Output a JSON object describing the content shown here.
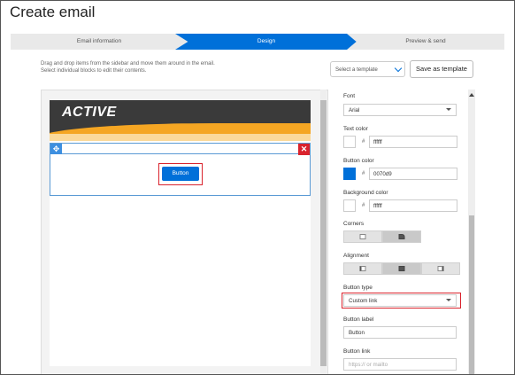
{
  "page": {
    "title": "Create email"
  },
  "steps": [
    {
      "label": "Email information",
      "active": false
    },
    {
      "label": "Design",
      "active": true
    },
    {
      "label": "Preview & send",
      "active": false
    }
  ],
  "instructions": {
    "line1": "Drag and drop items from the sidebar and move them around in the email.",
    "line2": "Select individual blocks to edit their contents."
  },
  "toolbar": {
    "template_select_value": "Select a template",
    "save_template_label": "Save as template"
  },
  "email": {
    "logo_text": "ACTIVE",
    "button_text": "Button"
  },
  "panel": {
    "font": {
      "label": "Font",
      "value": "Arial"
    },
    "text_color": {
      "label": "Text color",
      "hash": "#",
      "value": "ffffff",
      "swatch": "#ffffff"
    },
    "button_color": {
      "label": "Button color",
      "hash": "#",
      "value": "0070d9",
      "swatch": "#0070d9"
    },
    "background_color": {
      "label": "Background color",
      "hash": "#",
      "value": "ffffff",
      "swatch": "#ffffff"
    },
    "corners": {
      "label": "Corners",
      "options": [
        "square",
        "rounded"
      ],
      "selected": "rounded"
    },
    "alignment": {
      "label": "Alignment",
      "options": [
        "left",
        "center",
        "right"
      ],
      "selected": "center"
    },
    "button_type": {
      "label": "Button type",
      "value": "Custom link"
    },
    "button_label": {
      "label": "Button label",
      "value": "Button"
    },
    "button_link": {
      "label": "Button link",
      "placeholder": "https:// or mailto"
    }
  },
  "colors": {
    "accent": "#0070d9",
    "highlight": "#d9232d",
    "banner_dark": "#3a3a3a",
    "banner_orange": "#f5a623"
  }
}
